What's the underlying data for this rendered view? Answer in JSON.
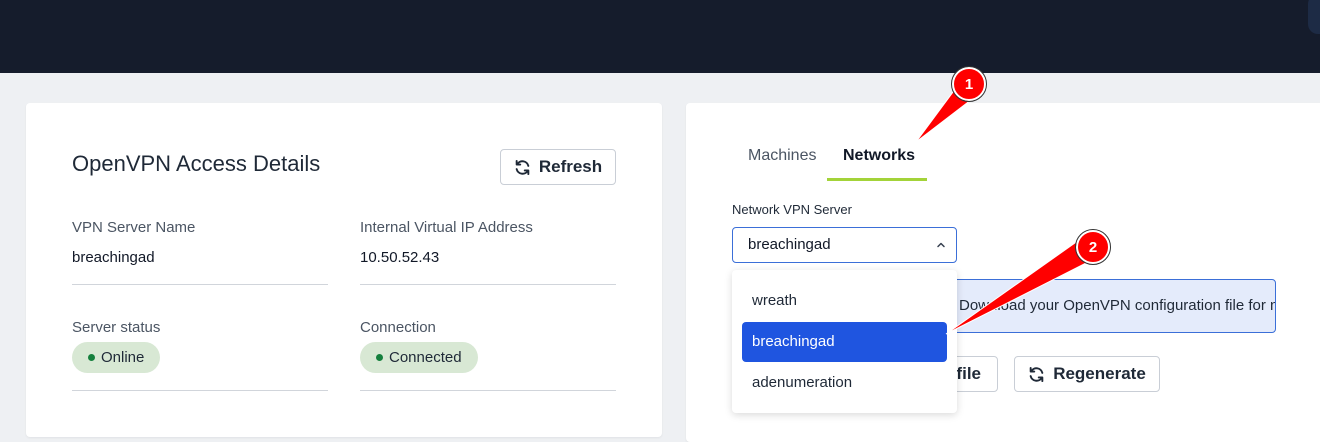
{
  "left_panel": {
    "title": "OpenVPN Access Details",
    "refresh_label": "Refresh",
    "vpn_server_name_label": "VPN Server Name",
    "vpn_server_name_value": "breachingad",
    "internal_ip_label": "Internal Virtual IP Address",
    "internal_ip_value": "10.50.52.43",
    "server_status_label": "Server status",
    "server_status_value": "Online",
    "connection_label": "Connection",
    "connection_value": "Connected"
  },
  "right_panel": {
    "tabs": [
      {
        "label": "Machines",
        "active": false
      },
      {
        "label": "Networks",
        "active": true
      }
    ],
    "select_label": "Network VPN Server",
    "select_value": "breachingad",
    "dropdown_options": [
      {
        "label": "wreath",
        "selected": false
      },
      {
        "label": "breachingad",
        "selected": true
      },
      {
        "label": "adenumeration",
        "selected": false
      }
    ],
    "info_text": "Download your OpenVPN configuration file for networks.",
    "download_label": "Download configuration file",
    "regenerate_label": "Regenerate"
  },
  "annotations": [
    {
      "number": "1"
    },
    {
      "number": "2"
    }
  ],
  "colors": {
    "topbar": "#151c2c",
    "accent_underline": "#a3d339",
    "select_border": "#3b6fd8",
    "selected_option": "#1f55e0",
    "annotation": "#ff0000",
    "status_pill": "#d8e8d4",
    "status_dot": "#15803d"
  }
}
